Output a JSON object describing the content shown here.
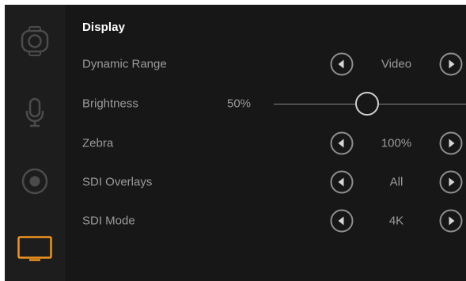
{
  "sidebar": {
    "items": [
      {
        "name": "camera-icon",
        "active": false
      },
      {
        "name": "microphone-icon",
        "active": false
      },
      {
        "name": "record-icon",
        "active": false
      },
      {
        "name": "monitor-icon",
        "active": true
      }
    ],
    "accent_color": "#f0941e"
  },
  "display": {
    "title": "Display",
    "rows": [
      {
        "label": "Dynamic Range",
        "value": "Video"
      },
      {
        "label": "Brightness",
        "value": "50%",
        "level": 0.5
      },
      {
        "label": "Zebra",
        "value": "100%"
      },
      {
        "label": "SDI Overlays",
        "value": "All"
      },
      {
        "label": "SDI Mode",
        "value": "4K"
      }
    ]
  },
  "icons": {
    "prev": "left-arrow-icon",
    "next": "right-arrow-icon"
  },
  "colors": {
    "background": "#171717",
    "sidebar": "#1d1d1d",
    "text_primary": "#ffffff",
    "text_secondary": "#9b9b9b"
  }
}
